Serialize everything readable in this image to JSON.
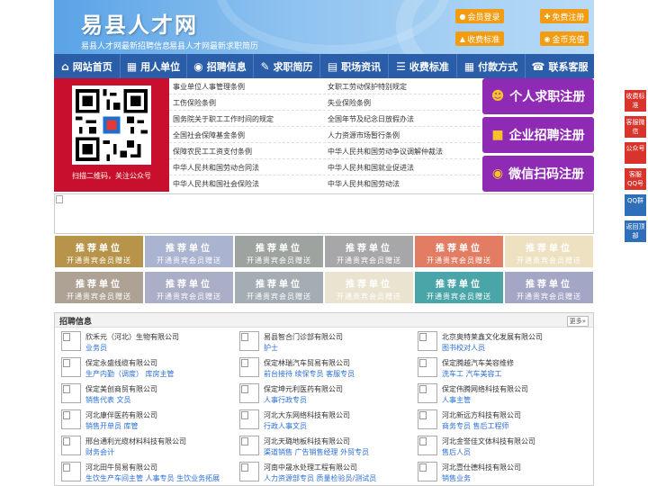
{
  "header": {
    "site_title": "易县人才网",
    "notes": [
      "易县人才网最新招聘信息",
      "易县人才网最新求职简历"
    ],
    "buttons": [
      {
        "label": "会员登录",
        "icon": "user-icon"
      },
      {
        "label": "免费注册",
        "icon": "user-add-icon"
      },
      {
        "label": "收费标准",
        "icon": "price-icon"
      },
      {
        "label": "金币充值",
        "icon": "coin-icon"
      }
    ]
  },
  "nav": [
    {
      "label": "网站首页",
      "icon": "home-icon"
    },
    {
      "label": "用人单位",
      "icon": "building-icon"
    },
    {
      "label": "招聘信息",
      "icon": "broadcast-icon"
    },
    {
      "label": "求职简历",
      "icon": "resume-icon"
    },
    {
      "label": "职场资讯",
      "icon": "news-icon"
    },
    {
      "label": "收费标准",
      "icon": "price-icon"
    },
    {
      "label": "付款方式",
      "icon": "payment-icon"
    },
    {
      "label": "联系客服",
      "icon": "phone-icon"
    }
  ],
  "qr": {
    "caption": "扫描二维码，关注公众号"
  },
  "laws": [
    [
      "事业单位人事管理条例",
      "女职工劳动保护特别规定"
    ],
    [
      "工伤保险条例",
      "失业保险条例"
    ],
    [
      "国务院关于职工工作时间的规定",
      "全国年节及纪念日放假办法"
    ],
    [
      "全国社会保障基金条例",
      "人力资源市场暂行条例"
    ],
    [
      "保障农民工工资支付条例",
      "中华人民共和国劳动争议调解仲裁法"
    ],
    [
      "中华人民共和国劳动合同法",
      "中华人民共和国就业促进法"
    ],
    [
      "中华人民共和国社会保险法",
      "中华人民共和国劳动法"
    ]
  ],
  "register": [
    {
      "label": "个人求职注册",
      "icon": "person-icon"
    },
    {
      "label": "企业招聘注册",
      "icon": "company-icon"
    },
    {
      "label": "微信扫码注册",
      "icon": "wechat-icon"
    }
  ],
  "tiles": {
    "title": "推荐单位",
    "subtitle": "开通贵宾会员赠送",
    "colors": [
      "#b8944b",
      "#aab3cf",
      "#9fa39f",
      "#a7a7aa",
      "#e27c62",
      "#ede1c2",
      "#aea294",
      "#aaaec6",
      "#a3adb3",
      "#e9e3cf",
      "#4aa5a8",
      "#a3a6c5"
    ]
  },
  "jobs": {
    "title": "招聘信息",
    "more": "更多»",
    "items": [
      {
        "company": "欣禾元（河北）生物有限公司",
        "positions": "业务员"
      },
      {
        "company": "易县智合门诊部有限公司",
        "positions": "护士"
      },
      {
        "company": "北京奥特莱鑫文化发展有限公司",
        "positions": "图书校对人员"
      },
      {
        "company": "保定永盛线缆有限公司",
        "positions": "生产内勤（调度） 库房主管"
      },
      {
        "company": "保定林瑞汽车贸易有限公司",
        "positions": "前台接待 续保专员 客服专员"
      },
      {
        "company": "保定腾越汽车美容维修",
        "positions": "洗车工 汽车美容工"
      },
      {
        "company": "保定美创商贸有限公司",
        "positions": "销售代表 文员"
      },
      {
        "company": "保定坤元利医药有限公司",
        "positions": "人事行政专员"
      },
      {
        "company": "保定伟腾网络科技有限公司",
        "positions": "人事主管"
      },
      {
        "company": "河北康伴医药有限公司",
        "positions": "销售开单员 库管"
      },
      {
        "company": "河北大东网络科技有限公司",
        "positions": "行政人事文员"
      },
      {
        "company": "河北新远方科技有限公司",
        "positions": "商务专员 售后工程师"
      },
      {
        "company": "邢台通利光缆材料科技有限公司",
        "positions": "财务会计"
      },
      {
        "company": "河北天璐地板科技有限公司",
        "positions": "渠道销售 广告销售经理 外贸专员"
      },
      {
        "company": "河北金誉佳文体科技有限公司",
        "positions": "售后人员"
      },
      {
        "company": "河北田牛贸易有限公司",
        "positions": "生饮生产车间主管 人事专员 生饮业务拓展"
      },
      {
        "company": "河南中晟水处理工程有限公司",
        "positions": "人力资源部专员 质量检验员/测试员"
      },
      {
        "company": "河北壹仕德科技有限公司",
        "positions": "销售业务"
      }
    ]
  },
  "sidebar": [
    {
      "label": "收费标准"
    },
    {
      "label": "客服微信"
    },
    {
      "label": "公众号"
    },
    {
      "label": "客服QQ号"
    },
    {
      "label": "QQ群"
    },
    {
      "label": "返回顶部"
    }
  ],
  "colors": {
    "nav_bg": "#2b5ea8",
    "accent_orange": "#f39c12",
    "register_purple": "#8e2ab3",
    "qr_red": "#c8102e",
    "link_blue": "#2a6fd6"
  }
}
